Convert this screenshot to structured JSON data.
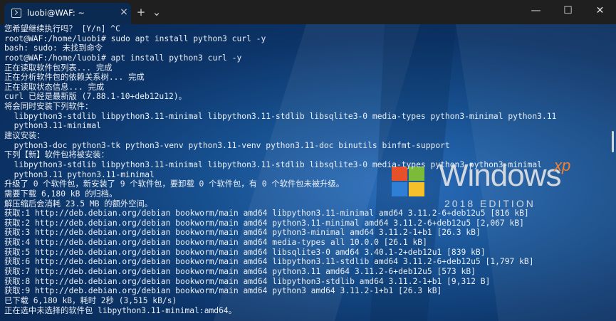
{
  "window": {
    "tab_title": "luobi@WAF: ~",
    "tab_close": "×",
    "new_tab": "+",
    "dropdown": "⌄",
    "minimize": "—",
    "maximize": "☐",
    "close": "✕"
  },
  "watermark": {
    "word": "Windows",
    "xp": "xp",
    "edition": "2018 EDITION",
    "flag_colors": [
      "#e8502a",
      "#7cbb3a",
      "#2f7fd6",
      "#f5c02a"
    ]
  },
  "terminal": {
    "lines": [
      "您希望继续执行吗？ [Y/n] ^C",
      "root@WAF:/home/luobi# sudo apt install python3 curl -y",
      "bash: sudo: 未找到命令",
      "root@WAF:/home/luobi# apt install python3 curl -y",
      "正在读取软件包列表... 完成",
      "正在分析软件包的依赖关系树... 完成",
      "正在读取状态信息... 完成",
      "curl 已经是最新版 (7.88.1-10+deb12u12)。",
      "将会同时安装下列软件：",
      "  libpython3-stdlib libpython3.11-minimal libpython3.11-stdlib libsqlite3-0 media-types python3-minimal python3.11",
      "  python3.11-minimal",
      "建议安装：",
      "  python3-doc python3-tk python3-venv python3.11-venv python3.11-doc binutils binfmt-support",
      "下列【新】软件包将被安装：",
      "  libpython3-stdlib libpython3.11-minimal libpython3.11-stdlib libsqlite3-0 media-types python3 python3-minimal",
      "  python3.11 python3.11-minimal",
      "升级了 0 个软件包，新安装了 9 个软件包，要卸载 0 个软件包，有 0 个软件包未被升级。",
      "需要下载 6,180 kB 的归档。",
      "解压缩后会消耗 23.5 MB 的额外空间。",
      "获取:1 http://deb.debian.org/debian bookworm/main amd64 libpython3.11-minimal amd64 3.11.2-6+deb12u5 [816 kB]",
      "获取:2 http://deb.debian.org/debian bookworm/main amd64 python3.11-minimal amd64 3.11.2-6+deb12u5 [2,067 kB]",
      "获取:3 http://deb.debian.org/debian bookworm/main amd64 python3-minimal amd64 3.11.2-1+b1 [26.3 kB]",
      "获取:4 http://deb.debian.org/debian bookworm/main amd64 media-types all 10.0.0 [26.1 kB]",
      "获取:5 http://deb.debian.org/debian bookworm/main amd64 libsqlite3-0 amd64 3.40.1-2+deb12u1 [839 kB]",
      "获取:6 http://deb.debian.org/debian bookworm/main amd64 libpython3.11-stdlib amd64 3.11.2-6+deb12u5 [1,797 kB]",
      "获取:7 http://deb.debian.org/debian bookworm/main amd64 python3.11 amd64 3.11.2-6+deb12u5 [573 kB]",
      "获取:8 http://deb.debian.org/debian bookworm/main amd64 libpython3-stdlib amd64 3.11.2-1+b1 [9,312 B]",
      "获取:9 http://deb.debian.org/debian bookworm/main amd64 python3 amd64 3.11.2-1+b1 [26.3 kB]",
      "已下载 6,180 kB，耗时 2秒 (3,515 kB/s)",
      "正在选中未选择的软件包 libpython3.11-minimal:amd64。"
    ]
  }
}
